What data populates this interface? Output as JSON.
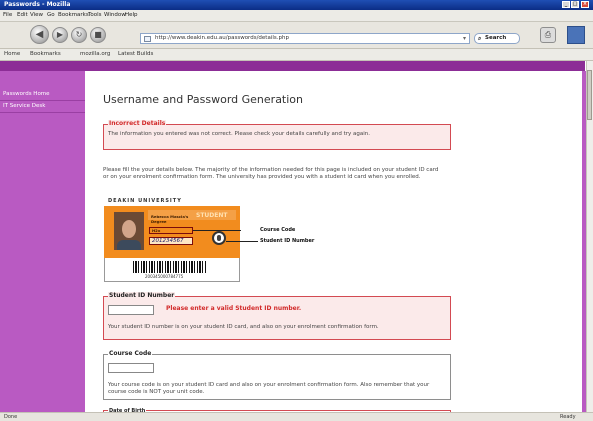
{
  "window": {
    "title": "Passwords - Mozilla",
    "buttons": [
      "_",
      "□",
      "×"
    ]
  },
  "menu": [
    "File",
    "Edit",
    "View",
    "Go",
    "Bookmarks",
    "Tools",
    "Window",
    "Help"
  ],
  "nav": {
    "url": "http://www.deakin.edu.au/passwords/details.php",
    "search_label": "Search"
  },
  "bookmarks": [
    "Home",
    "Bookmarks",
    "mozilla.org",
    "Latest Builds"
  ],
  "sidebar": {
    "items": [
      {
        "label": "Passwords Home"
      },
      {
        "label": "IT Service Desk"
      }
    ]
  },
  "page": {
    "title": "Username and Password Generation",
    "error_box": {
      "legend": "Incorrect Details",
      "text": "The information you entered was not correct. Please check your details carefully and try again."
    },
    "intro": "Please fill the your details below. The majority of the information needed for this page is included on your student ID card or on your enrolment confirmation form. The university has provided you with a student id card when you enrolled."
  },
  "card": {
    "university": "DEAKIN UNIVERSITY",
    "type": "STUDENT",
    "name_line1": "Rebecca Mascia's",
    "name_line2": "Degree",
    "course_code": "H2x",
    "signature": "201234567",
    "barcode_number": "200345000784775",
    "callouts": {
      "course": "Course Code",
      "student_id": "Student ID Number"
    }
  },
  "student_id": {
    "legend": "Student ID Number",
    "input_value": "",
    "error": "Please enter a valid Student ID number.",
    "help": "Your student ID number is on your student ID card, and also on your enrolment confirmation form."
  },
  "course_code": {
    "legend": "Course Code",
    "input_value": "",
    "help": "Your course code is on your student ID card and also on your enrolment confirmation form. Also remember that your course code is NOT your unit code."
  },
  "dob": {
    "legend": "Date of Birth"
  },
  "status": {
    "left": "Done",
    "right": "Ready"
  },
  "colors": {
    "purple_dark": "#8c2d96",
    "purple_light": "#b95ac2",
    "error_red": "#d22a2a",
    "error_bg": "#fbeaea",
    "card_orange": "#f28c1e"
  }
}
